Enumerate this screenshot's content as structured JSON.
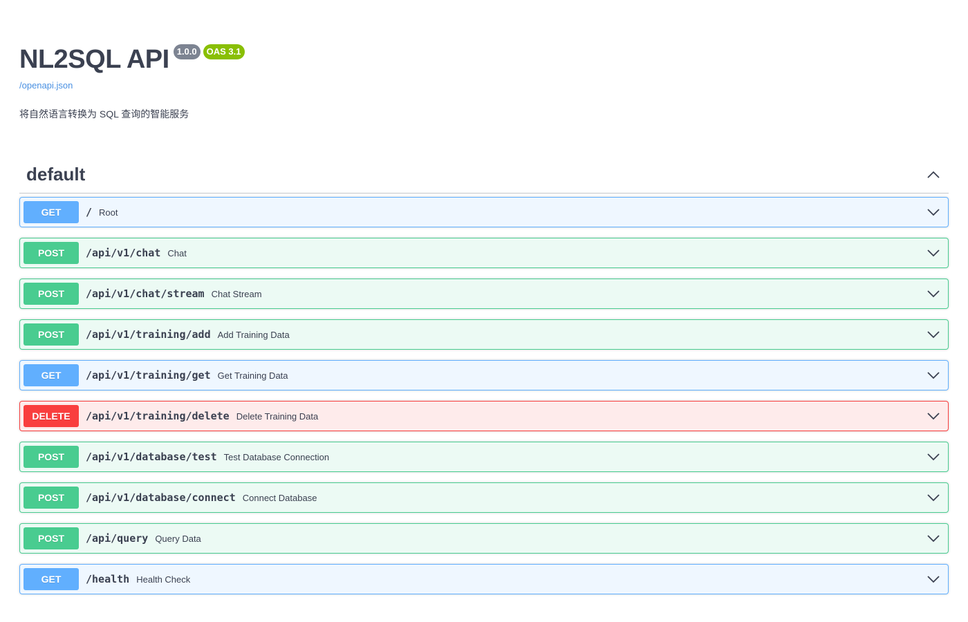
{
  "info": {
    "title": "NL2SQL API",
    "version": "1.0.0",
    "oas": "OAS 3.1",
    "spec_link": "/openapi.json",
    "description": "将自然语言转换为 SQL 查询的智能服务"
  },
  "section": {
    "title": "default"
  },
  "operations": [
    {
      "method": "GET",
      "path": "/",
      "summary": "Root"
    },
    {
      "method": "POST",
      "path": "/api/v1/chat",
      "summary": "Chat"
    },
    {
      "method": "POST",
      "path": "/api/v1/chat/stream",
      "summary": "Chat Stream"
    },
    {
      "method": "POST",
      "path": "/api/v1/training/add",
      "summary": "Add Training Data"
    },
    {
      "method": "GET",
      "path": "/api/v1/training/get",
      "summary": "Get Training Data"
    },
    {
      "method": "DELETE",
      "path": "/api/v1/training/delete",
      "summary": "Delete Training Data"
    },
    {
      "method": "POST",
      "path": "/api/v1/database/test",
      "summary": "Test Database Connection"
    },
    {
      "method": "POST",
      "path": "/api/v1/database/connect",
      "summary": "Connect Database"
    },
    {
      "method": "POST",
      "path": "/api/query",
      "summary": "Query Data"
    },
    {
      "method": "GET",
      "path": "/health",
      "summary": "Health Check"
    }
  ],
  "colors": {
    "get": "#61affe",
    "post": "#49cc90",
    "delete": "#f93e3e",
    "version_badge": "#7d8492",
    "oas_badge": "#89bf04",
    "link": "#4990e2"
  },
  "icons": {
    "section_toggle": "chevron-up-icon",
    "operation_toggle": "chevron-down-icon"
  }
}
